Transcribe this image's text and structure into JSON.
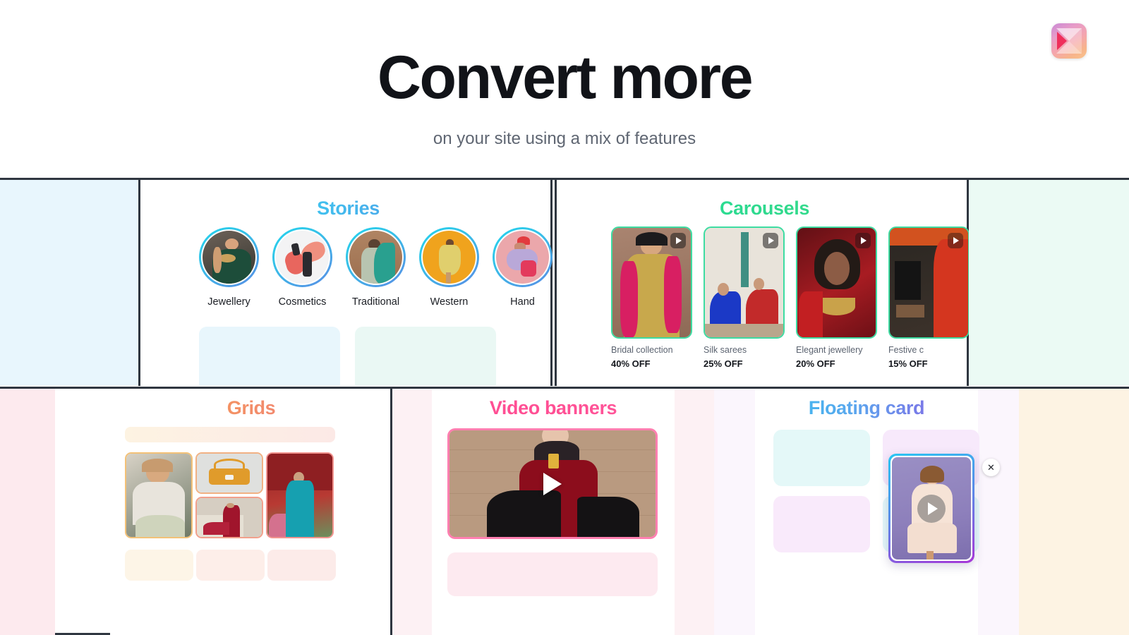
{
  "hero": {
    "title": "Convert more",
    "subtitle": "on your site using a mix of features"
  },
  "logo": {
    "name": "brand-logo"
  },
  "sections": {
    "stories": {
      "title": "Stories",
      "items": [
        {
          "label": "Jewellery"
        },
        {
          "label": "Cosmetics"
        },
        {
          "label": "Traditional"
        },
        {
          "label": "Western"
        },
        {
          "label": "Hand"
        }
      ]
    },
    "carousels": {
      "title": "Carousels",
      "items": [
        {
          "caption": "Bridal collection",
          "offer": "40% OFF"
        },
        {
          "caption": "Silk sarees",
          "offer": "25% OFF"
        },
        {
          "caption": "Elegant jewellery",
          "offer": "20% OFF"
        },
        {
          "caption": "Festive c",
          "offer": "15% OFF"
        }
      ]
    },
    "grids": {
      "title": "Grids"
    },
    "video": {
      "title": "Video banners"
    },
    "floating": {
      "title": "Floating card",
      "close_label": "✕"
    }
  },
  "colors": {
    "page_background": "#ffffff",
    "divider": "#2f3640",
    "band_stories": "#e8f6fd",
    "band_carousels": "#ebfaf4",
    "band_grids": "#fdeaee",
    "band_floating": "#fdf3e3",
    "title_stories_from": "#22d3ee",
    "title_stories_to": "#5b86e5",
    "title_carousels_from": "#22e39a",
    "title_carousels_to": "#3ddc84",
    "title_grids_from": "#f7a64a",
    "title_grids_to": "#ef6f7e",
    "title_video": "#ff4e93",
    "title_floating_from": "#22c9f0",
    "title_floating_to": "#a23ae0"
  }
}
